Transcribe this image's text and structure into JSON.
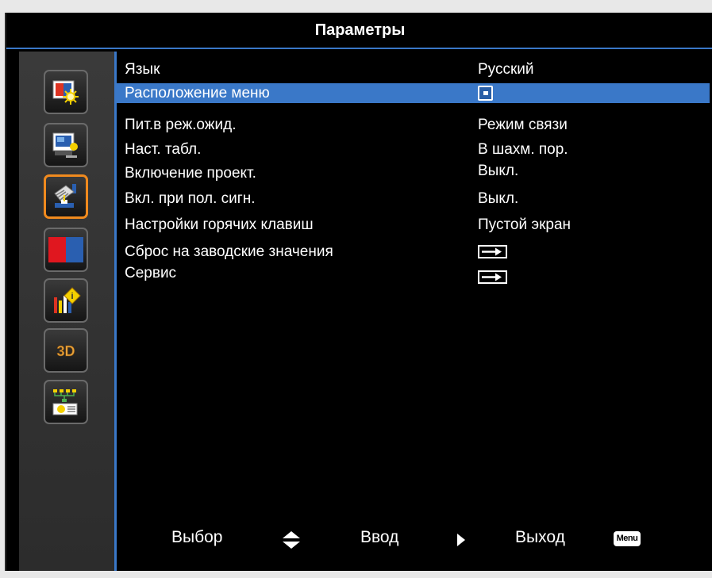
{
  "title": "Параметры",
  "sidebar": {
    "items": [
      {
        "icon": "image-settings-icon",
        "active": false
      },
      {
        "icon": "display-settings-icon",
        "active": false
      },
      {
        "icon": "setup-hand-icon",
        "active": true
      },
      {
        "icon": "color-icon",
        "active": false
      },
      {
        "icon": "information-icon",
        "active": false
      },
      {
        "icon": "3d-icon",
        "label": "3D",
        "active": false
      },
      {
        "icon": "network-icon",
        "active": false
      }
    ]
  },
  "menu": {
    "rows": [
      {
        "label": "Язык",
        "value": "Русский"
      },
      {
        "label": "Расположение меню",
        "value_icon": "menu-position-icon",
        "selected": true
      },
      {
        "label": "Пит.в реж.ожид.",
        "value": "Режим связи"
      },
      {
        "label": "Наст. табл.",
        "value": "В шахм. пор."
      },
      {
        "label": "Включение проект.",
        "value": "Выкл."
      },
      {
        "label": "Вкл. при пол. сигн.",
        "value": "Выкл."
      },
      {
        "label": "Настройки горячих клавиш",
        "value": "Пустой экран"
      },
      {
        "label": "Сброс на заводские значения",
        "value_icon": "enter-arrow-icon"
      },
      {
        "label": "Сервис",
        "value_icon": "enter-arrow-icon"
      }
    ]
  },
  "footer": {
    "select_label": "Выбор",
    "enter_label": "Ввод",
    "exit_label": "Выход",
    "menu_key_label": "Menu"
  },
  "colors": {
    "accent_blue": "#3a78c8",
    "active_orange": "#f08a1e"
  }
}
